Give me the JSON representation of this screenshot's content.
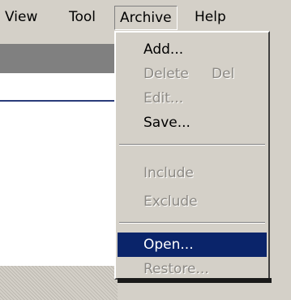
{
  "menubar": {
    "items": [
      {
        "label": "View"
      },
      {
        "label": "Tool"
      },
      {
        "label": "Archive"
      },
      {
        "label": "Help"
      }
    ]
  },
  "archive_menu": {
    "items": [
      {
        "label": "Add...",
        "enabled": true
      },
      {
        "label": "Delete",
        "shortcut": "Del",
        "enabled": false
      },
      {
        "label": "Edit...",
        "enabled": false
      },
      {
        "label": "Save...",
        "enabled": true
      },
      {
        "label": "Include",
        "enabled": false
      },
      {
        "label": "Exclude",
        "enabled": false
      },
      {
        "label": "Open...",
        "enabled": true,
        "selected": true
      },
      {
        "label": "Restore...",
        "enabled": false
      }
    ]
  },
  "colors": {
    "menu_bg": "#d4d0c8",
    "highlight": "#0a246a",
    "disabled_text": "#8c8984"
  }
}
